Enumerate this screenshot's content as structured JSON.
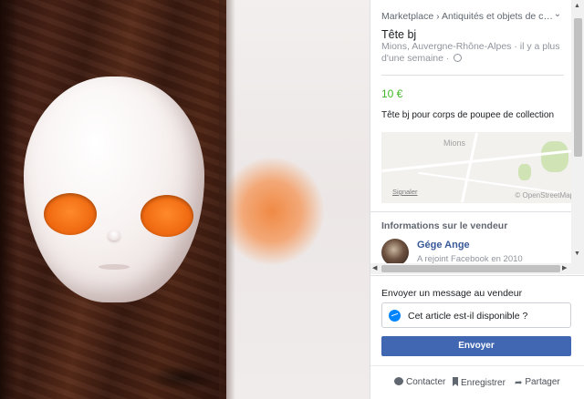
{
  "listing": {
    "breadcrumb": "Marketplace › Antiquités et objets de coll...",
    "title": "Tête bj",
    "location": "Mions, Auvergne-Rhône-Alpes · il y a plus d'une semaine ·",
    "price": "10 €",
    "description": "Tête bj pour corps de poupee de collection"
  },
  "map": {
    "city": "Mions",
    "report_link": "Signaler",
    "attribution": "© OpenStreetMap"
  },
  "seller": {
    "heading": "Informations sur le vendeur",
    "name": "Gége Ange",
    "joined": "A rejoint Facebook en 2010"
  },
  "message": {
    "heading": "Envoyer un message au vendeur",
    "text": "Cet article est-il disponible ?",
    "send_label": "Envoyer"
  },
  "actions": {
    "contact": "Contacter",
    "save": "Enregistrer",
    "share": "Partager"
  },
  "colors": {
    "price": "#42b72a",
    "primary_button": "#4267b2",
    "link": "#385898"
  }
}
